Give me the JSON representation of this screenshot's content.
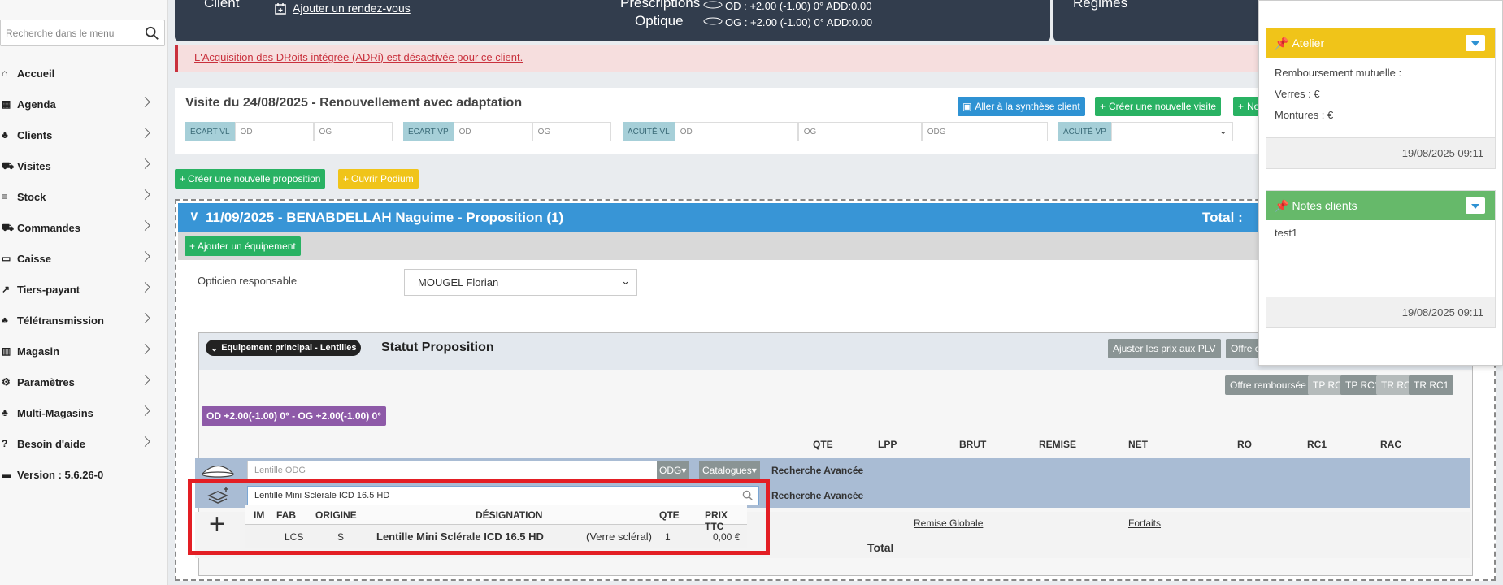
{
  "sidebar": {
    "search_placeholder": "Recherche dans le menu",
    "items": [
      {
        "label": "Accueil",
        "icon": "home-icon",
        "chevron": false
      },
      {
        "label": "Agenda",
        "icon": "calendar-icon",
        "chevron": true
      },
      {
        "label": "Clients",
        "icon": "users-icon",
        "chevron": true
      },
      {
        "label": "Visites",
        "icon": "cart-icon",
        "chevron": true
      },
      {
        "label": "Stock",
        "icon": "database-icon",
        "chevron": true
      },
      {
        "label": "Commandes",
        "icon": "truck-icon",
        "chevron": true
      },
      {
        "label": "Caisse",
        "icon": "money-icon",
        "chevron": true
      },
      {
        "label": "Tiers-payant",
        "icon": "external-link-icon",
        "chevron": true
      },
      {
        "label": "Télétransmission",
        "icon": "users-icon",
        "chevron": true
      },
      {
        "label": "Magasin",
        "icon": "building-icon",
        "chevron": true
      },
      {
        "label": "Paramètres",
        "icon": "gear-icon",
        "chevron": true
      },
      {
        "label": "Multi-Magasins",
        "icon": "users-icon",
        "chevron": true
      },
      {
        "label": "Besoin d'aide",
        "icon": "question-icon",
        "chevron": true
      },
      {
        "label": "Version : 5.6.26-0",
        "icon": "server-icon",
        "chevron": false
      }
    ]
  },
  "top": {
    "client_title": "Client",
    "rdv_link": "Ajouter un rendez-vous",
    "presc_title": "Prescriptions",
    "optique_title": "Optique",
    "od_line": "OD : +2.00 (-1.00) 0° ADD:0.00",
    "og_line": "OG : +2.00 (-1.00) 0° ADD:0.00",
    "regimes_title": "Régimes"
  },
  "alert": "L'Acquisition des DRoits intégrée (ADRi) est désactivée pour ce client.",
  "visit": {
    "title": "Visite du 24/08/2025 - Renouvellement avec adaptation",
    "btn_synthese": "Aller à la synthèse client",
    "btn_new_visit": "Créer une nouvelle visite",
    "btn_no": "No",
    "ecart_vl": "ECART VL",
    "ecart_vp": "ECART VP",
    "acuite_vl": "ACUITÉ VL",
    "acuite_vp": "ACUITÉ VP",
    "od": "OD",
    "og": "OG",
    "odg": "ODG"
  },
  "actions": {
    "new_prop": "Créer une nouvelle proposition",
    "podium": "Ouvrir Podium"
  },
  "proposition": {
    "title": "11/09/2025 - BENABDELLAH Naguime - Proposition (1)",
    "total_label": "Total :",
    "add_equipment": "Ajouter un équipement",
    "opticien_label": "Opticien responsable",
    "opticien_value": "MOUGEL Florian",
    "equip_pill": "Equipement principal - Lentilles",
    "statut": "Statut Proposition",
    "btn_ajuster": "Ajuster les prix aux PLV",
    "btn_offre_cut": "Offre co",
    "btn_offre_remb": "Offre remboursée",
    "tp_ro": "TP RO",
    "tp_rc1": "TP RC1",
    "tr_ro": "TR RO",
    "tr_rc1": "TR RC1",
    "rx_pill": "OD +2.00(-1.00) 0° - OG +2.00(-1.00) 0°",
    "columns": [
      "QTE",
      "LPP",
      "BRUT",
      "REMISE",
      "NET",
      "RO",
      "RC1",
      "RAC"
    ],
    "row1_placeholder": "Lentille ODG",
    "row1_eye": "ODG",
    "catalogues": "Catalogues",
    "recherche": "Recherche Avancée",
    "row2_value": "Lentille Mini Sclérale ICD 16.5 HD",
    "remise_globale": "Remise Globale",
    "forfaits": "Forfaits",
    "total": "Total"
  },
  "dropdown": {
    "headers": [
      "IM",
      "FAB",
      "ORIGINE",
      "DÉSIGNATION",
      "QTE",
      "PRIX TTC"
    ],
    "row": {
      "im": "",
      "fab": "LCS",
      "origine": "S",
      "designation_bold": "Lentille Mini Sclérale ICD 16.5 HD",
      "designation_rest": "(Verre scléral)",
      "qte": "1",
      "prix": "0,00 €"
    }
  },
  "right": {
    "atelier_title": "Atelier",
    "atelier_lines": [
      "Remboursement mutuelle :",
      "Verres : €",
      "Montures : €"
    ],
    "atelier_date": "19/08/2025 09:11",
    "notes_title": "Notes clients",
    "notes_text": "test1",
    "notes_date": "19/08/2025 09:11"
  },
  "colors": {
    "blue": "#3895d6",
    "green": "#29b263",
    "yellow": "#f0c419",
    "dark": "#323d4d",
    "red": "#e31e24",
    "purple": "#8e5aa8"
  }
}
